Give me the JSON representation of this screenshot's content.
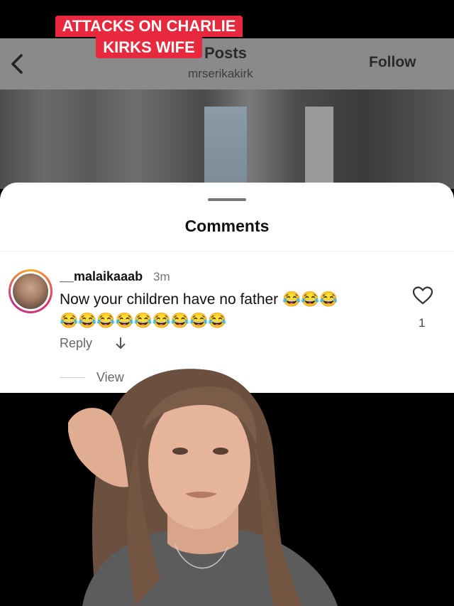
{
  "banner": {
    "line1": "ATTACKS ON CHARLIE",
    "line2": "KIRKS WIFE"
  },
  "header": {
    "title": "Posts",
    "username": "mrserikakirk",
    "follow_label": "Follow",
    "back_icon": "chevron-left-icon"
  },
  "comments_sheet": {
    "title": "Comments",
    "comment": {
      "username": "__malaikaaab",
      "time": "3m",
      "text_line1": "Now your children have no father 😂😂😂",
      "text_line2": "😂😂😂😂😂😂😂😂😂",
      "like_count": "1",
      "reply_label": "Reply",
      "view_replies_label": "View"
    }
  },
  "colors": {
    "banner_bg": "#e8293d",
    "sheet_bg": "#ffffff",
    "text": "#111111"
  }
}
